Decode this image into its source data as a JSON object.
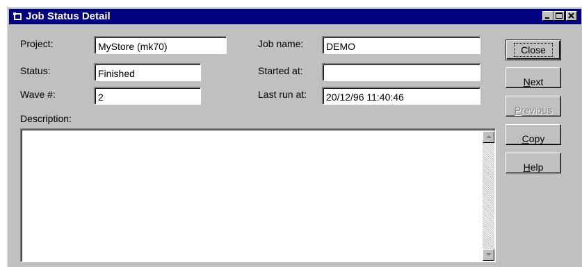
{
  "window": {
    "title": "Job Status Detail"
  },
  "fields": {
    "project": {
      "label": "Project:",
      "value": "MyStore (mk70)"
    },
    "status": {
      "label": "Status:",
      "value": "Finished"
    },
    "wave": {
      "label": "Wave #:",
      "value": "2"
    },
    "job_name": {
      "label": "Job name:",
      "value": "DEMO"
    },
    "started_at": {
      "label": "Started at:",
      "value": ""
    },
    "last_run_at": {
      "label": "Last run at:",
      "value": "20/12/96 11:40:46"
    }
  },
  "description": {
    "label": "Description:",
    "value": ""
  },
  "buttons": {
    "close": "Close",
    "next_mnemonic": "N",
    "next_rest": "ext",
    "previous_mnemonic": "P",
    "previous_rest": "revious",
    "copy_mnemonic": "C",
    "copy_rest": "opy",
    "help_mnemonic": "H",
    "help_rest": "elp"
  },
  "icons": {
    "app": "app-window-icon",
    "minimize": "minimize-icon",
    "maximize": "maximize-icon",
    "close": "close-icon",
    "scroll_up": "scroll-up-arrow-icon",
    "scroll_down": "scroll-down-arrow-icon"
  },
  "colors": {
    "titlebar": "#000080",
    "face": "#c0c0c0",
    "field": "#ffffff"
  }
}
